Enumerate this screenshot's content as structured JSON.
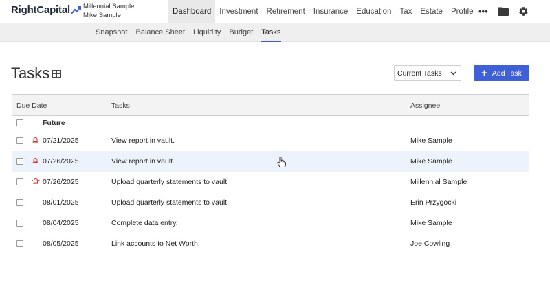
{
  "brand": {
    "logo_text": "RightCapital",
    "accent": "#3f5fd6"
  },
  "clients": {
    "primary": "Millennial Sample",
    "secondary": "Mike Sample"
  },
  "main_nav": [
    {
      "label": "Dashboard",
      "active": true
    },
    {
      "label": "Investment",
      "active": false
    },
    {
      "label": "Retirement",
      "active": false
    },
    {
      "label": "Insurance",
      "active": false
    },
    {
      "label": "Education",
      "active": false
    },
    {
      "label": "Tax",
      "active": false
    },
    {
      "label": "Estate",
      "active": false
    },
    {
      "label": "Profile",
      "active": false
    }
  ],
  "top_icons": {
    "more": "•••",
    "folder": "folder-icon",
    "settings": "gear-icon"
  },
  "sub_nav": [
    {
      "label": "Snapshot",
      "active": false
    },
    {
      "label": "Balance Sheet",
      "active": false
    },
    {
      "label": "Liquidity",
      "active": false
    },
    {
      "label": "Budget",
      "active": false
    },
    {
      "label": "Tasks",
      "active": true
    }
  ],
  "page": {
    "title": "Tasks",
    "filter_selected": "Current Tasks",
    "add_button": "Add Task"
  },
  "table": {
    "columns": {
      "due_date": "Due Date",
      "tasks": "Tasks",
      "assignee": "Assignee"
    },
    "group_label": "Future",
    "rows": [
      {
        "date": "07/21/2025",
        "task": "View report in vault.",
        "assignee": "Mike Sample",
        "alert": true
      },
      {
        "date": "07/26/2025",
        "task": "View report in vault.",
        "assignee": "Mike Sample",
        "alert": true
      },
      {
        "date": "07/26/2025",
        "task": "Upload quarterly statements to vault.",
        "assignee": "Millennial Sample",
        "alert": true
      },
      {
        "date": "08/01/2025",
        "task": "Upload quarterly statements to vault.",
        "assignee": "Erin Przygocki",
        "alert": false
      },
      {
        "date": "08/04/2025",
        "task": "Complete data entry.",
        "assignee": "Mike Sample",
        "alert": false
      },
      {
        "date": "08/05/2025",
        "task": "Link accounts to Net Worth.",
        "assignee": "Joe Cowling",
        "alert": false
      }
    ]
  },
  "colors": {
    "alert": "#d9342b",
    "hover_row": "#edf3fc"
  }
}
